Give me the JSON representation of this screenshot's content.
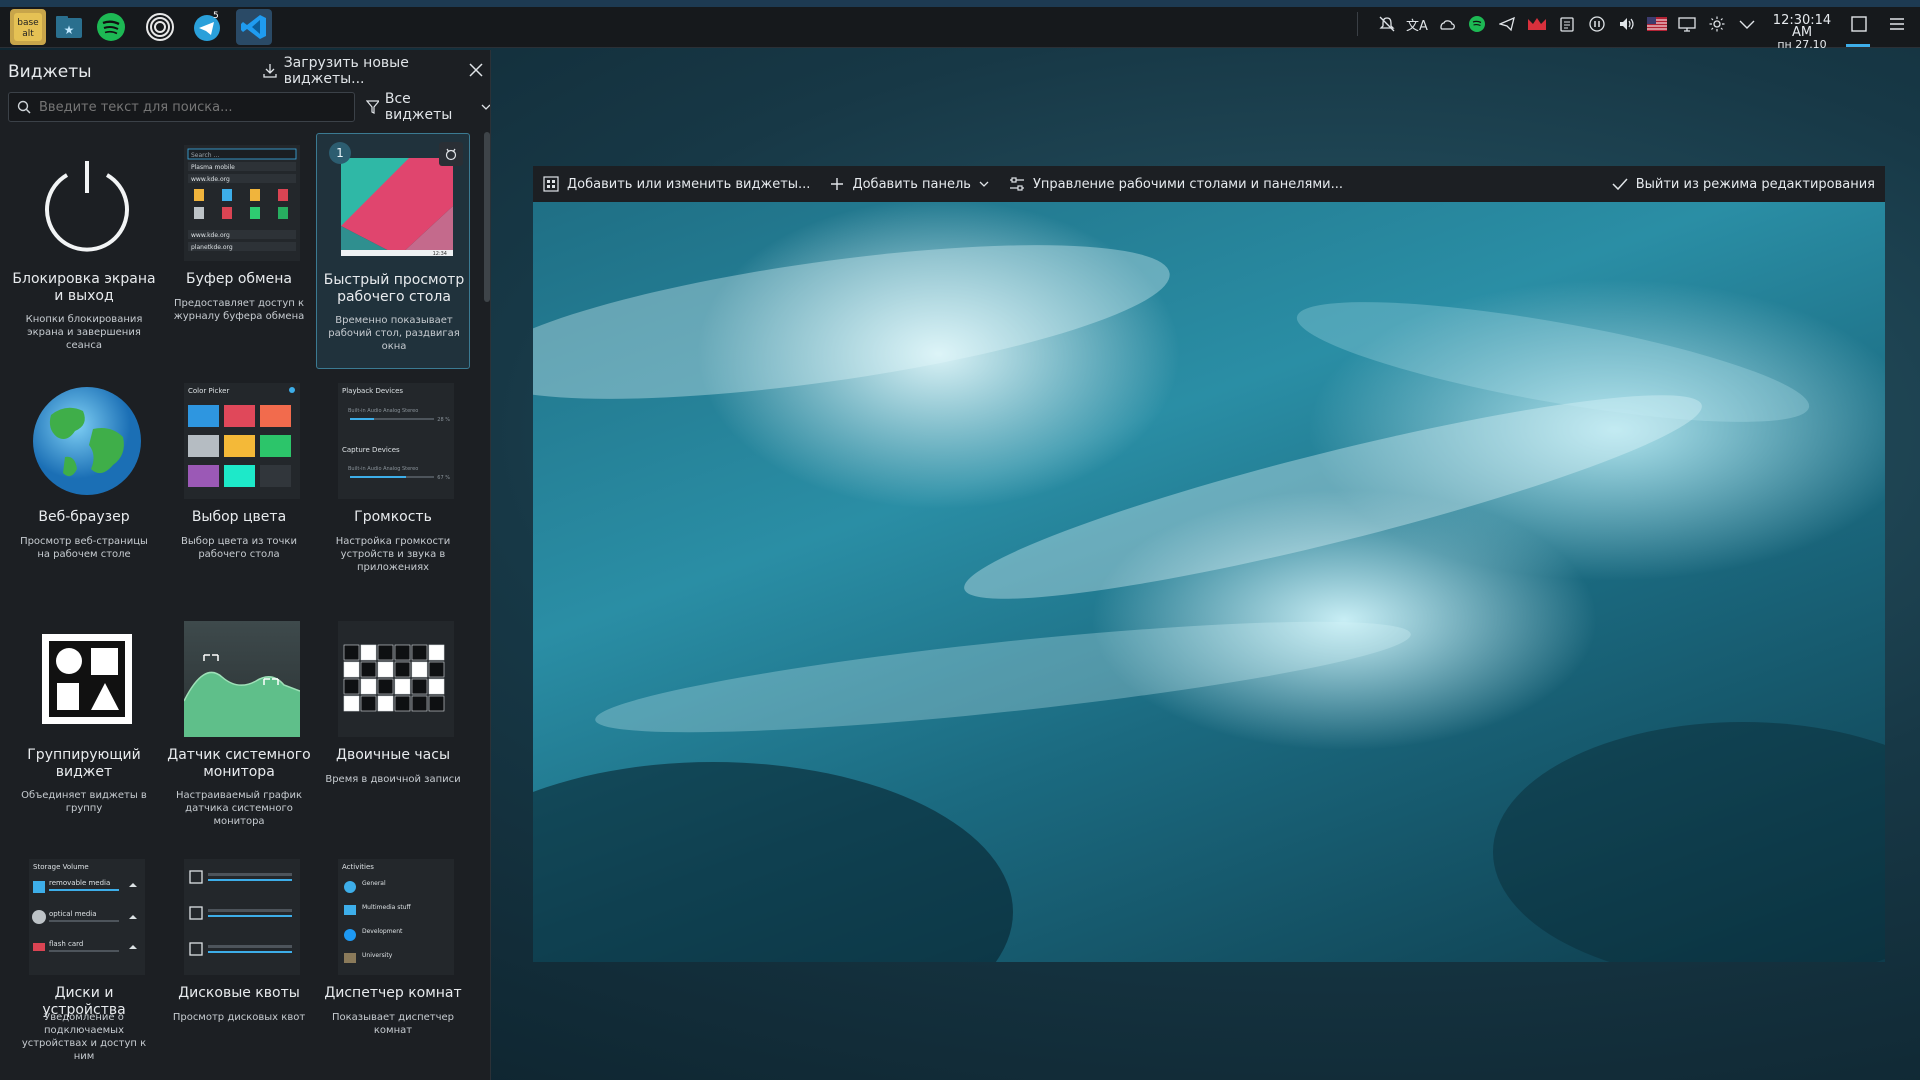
{
  "top_panel": {
    "apps": [
      {
        "name": "basealt",
        "label": "base alt"
      },
      {
        "name": "files"
      },
      {
        "name": "spotify"
      },
      {
        "name": "tor"
      },
      {
        "name": "telegram",
        "badge": "5"
      },
      {
        "name": "vscode"
      }
    ],
    "tray_icons": [
      "notifications-icon",
      "translate-icon",
      "cloud-icon",
      "spotify-tray-icon",
      "telegram-tray-icon",
      "crown-icon",
      "clipboard-icon",
      "media-pause-icon",
      "volume-icon",
      "us-flag-icon",
      "display-icon",
      "brightness-icon",
      "chevron-down-icon"
    ],
    "clock": {
      "time": "12:30:14 AM",
      "date": "пн 27.10"
    }
  },
  "explorer": {
    "title": "Виджеты",
    "download_label": "Загрузить новые виджеты...",
    "search_placeholder": "Введите текст для поиска...",
    "filter_label": "Все виджеты",
    "widgets": [
      {
        "name": "Блокировка экрана и выход",
        "desc": "Кнопки блокирования экрана и завершения сеанса"
      },
      {
        "name": "Буфер обмена",
        "desc": "Предоставляет доступ к журналу буфера обмена",
        "thumb": {
          "search": "Search ...",
          "l1": "Plasma mobile",
          "l2": "www.kde.org",
          "l3": "www.kde.org",
          "l4": "planetkde.org"
        }
      },
      {
        "name": "Быстрый просмотр рабочего стола",
        "desc": "Временно показывает рабочий стол, раздвигая окна",
        "badge": "1",
        "time": "12:34"
      },
      {
        "name": "Веб-браузер",
        "desc": "Просмотр веб-страницы на рабочем столе"
      },
      {
        "name": "Выбор цвета",
        "desc": "Выбор цвета из точки рабочего стола",
        "thumb": {
          "title": "Color Picker"
        }
      },
      {
        "name": "Громкость",
        "desc": "Настройка громкости устройств и звука в приложениях",
        "thumb": {
          "playback": "Playback Devices",
          "dev1": "Built-in Audio Analog Stereo",
          "pct1": "28 %",
          "capture": "Capture Devices",
          "dev2": "Built-in Audio Analog Stereo",
          "pct2": "67 %"
        }
      },
      {
        "name": "Группирующий виджет",
        "desc": "Объединяет виджеты в группу"
      },
      {
        "name": "Датчик системного монитора",
        "desc": "Настраиваемый график датчика системного монитора"
      },
      {
        "name": "Двоичные часы",
        "desc": "Время в двоичной записи"
      },
      {
        "name": "Диски и устройства",
        "desc": "Уведомление о подключаемых устройствах и доступ к ним",
        "thumb": {
          "title": "Storage Volume",
          "d1": "removable media",
          "d2": "optical media",
          "d3": "flash card"
        }
      },
      {
        "name": "Дисковые квоты",
        "desc": "Просмотр дисковых квот"
      },
      {
        "name": "Диспетчер комнат",
        "desc": "Показывает диспетчер комнат",
        "thumb": {
          "title": "Activities",
          "a1": "General",
          "a2": "Multimedia stuff",
          "a3": "Development",
          "a4": "University"
        }
      }
    ]
  },
  "editbar": {
    "add_widgets": "Добавить или изменить виджеты...",
    "add_panel": "Добавить панель",
    "manage": "Управление рабочими столами и панелями...",
    "exit": "Выйти из режима редактирования"
  },
  "colors": {
    "accent": "#3daee9",
    "panel_bg": "#16191c",
    "explorer_bg": "#1c1f23"
  }
}
